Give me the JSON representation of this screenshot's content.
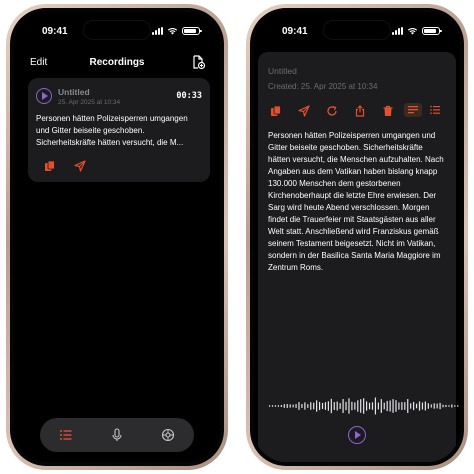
{
  "colors": {
    "accent": "#e2502d",
    "play": "#8e63d6",
    "card": "#1c1c1e",
    "muted": "#6c6c70"
  },
  "left": {
    "status_time": "09:41",
    "nav": {
      "edit_label": "Edit",
      "title": "Recordings",
      "add_icon": "new-document-icon"
    },
    "recording": {
      "title": "Untitled",
      "date": "25. Apr 2025 at 10:34",
      "duration": "00:33",
      "preview": "Personen hätten Polizeisperren umgangen und Gitter beiseite geschoben. Sicherheitskräfte hätten versucht, die M...",
      "actions": [
        "copy-icon",
        "share-icon"
      ]
    },
    "tabs": [
      "list-icon",
      "microphone-icon",
      "settings-icon"
    ]
  },
  "right": {
    "status_time": "09:41",
    "title": "Untitled",
    "created": "Created: 25. Apr 2025 at 10:34",
    "toolbar": [
      "copy-icon",
      "send-icon",
      "refresh-icon",
      "share-icon",
      "trash-icon"
    ],
    "view_modes": [
      "paragraph-view-icon",
      "list-view-icon"
    ],
    "transcript": "Personen hätten Polizeisperren umgangen und Gitter beiseite geschoben. Sicherheitskräfte hätten versucht, die Menschen aufzuhalten.  Nach Angaben aus dem Vatikan haben bislang knapp 130.000 Menschen dem gestorbenen Kirchenoberhaupt die letzte Ehre erwiesen. Der Sarg wird heute Abend verschlossen. Morgen findet die Trauerfeier mit Staatsgästen aus aller Welt statt. Anschließend wird Franziskus gemäß seinem Testament beigesetzt.  Nicht im Vatikan, sondern in der Basilica Santa Maria Maggiore im Zentrum Roms."
  }
}
